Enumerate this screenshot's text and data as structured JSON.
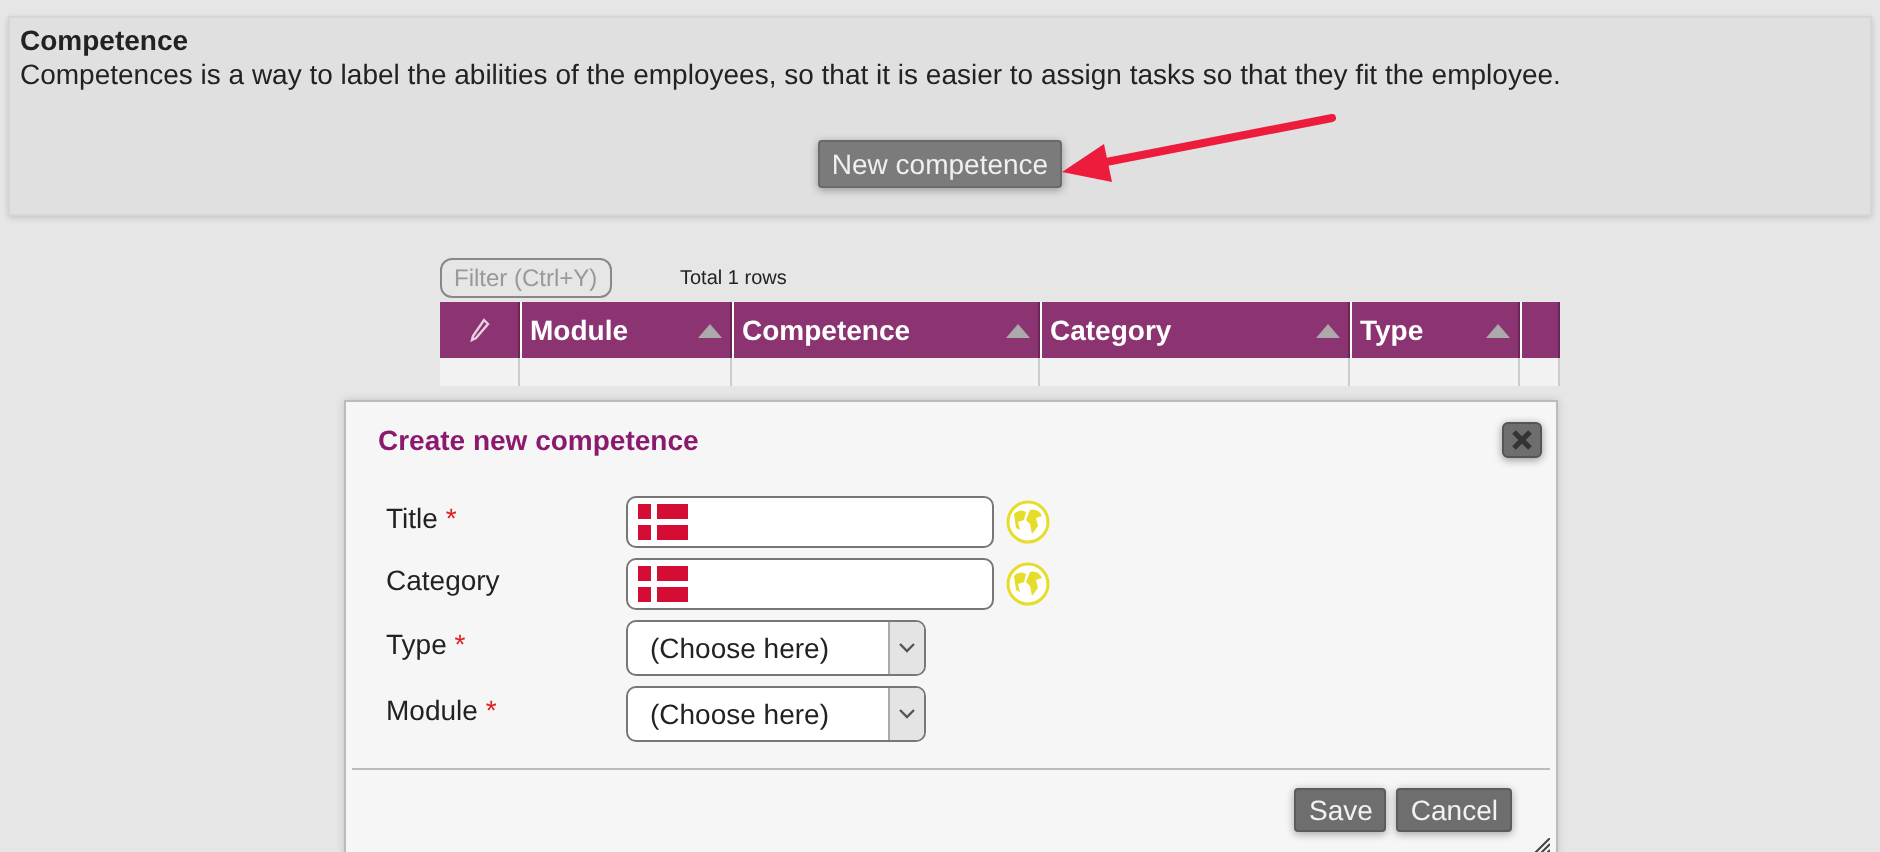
{
  "header": {
    "title": "Competence",
    "description": "Competences is a way to label the abilities of the employees, so that it is easier to assign tasks so that they fit the employee.",
    "button": "New competence"
  },
  "table": {
    "filter_placeholder": "Filter (Ctrl+Y)",
    "total": "Total 1 rows",
    "columns": [
      {
        "label": "Module"
      },
      {
        "label": "Competence"
      },
      {
        "label": "Category"
      },
      {
        "label": "Type"
      }
    ]
  },
  "dialog": {
    "title": "Create new competence",
    "fields": [
      {
        "label": "Title",
        "required_mark": "*",
        "kind": "text"
      },
      {
        "label": "Category",
        "kind": "text"
      },
      {
        "label": "Type",
        "required_mark": "*",
        "kind": "select",
        "value": "(Choose here)"
      },
      {
        "label": "Module",
        "required_mark": "*",
        "kind": "select",
        "value": "(Choose here)"
      }
    ],
    "buttons": [
      "Save",
      "Cancel"
    ]
  }
}
